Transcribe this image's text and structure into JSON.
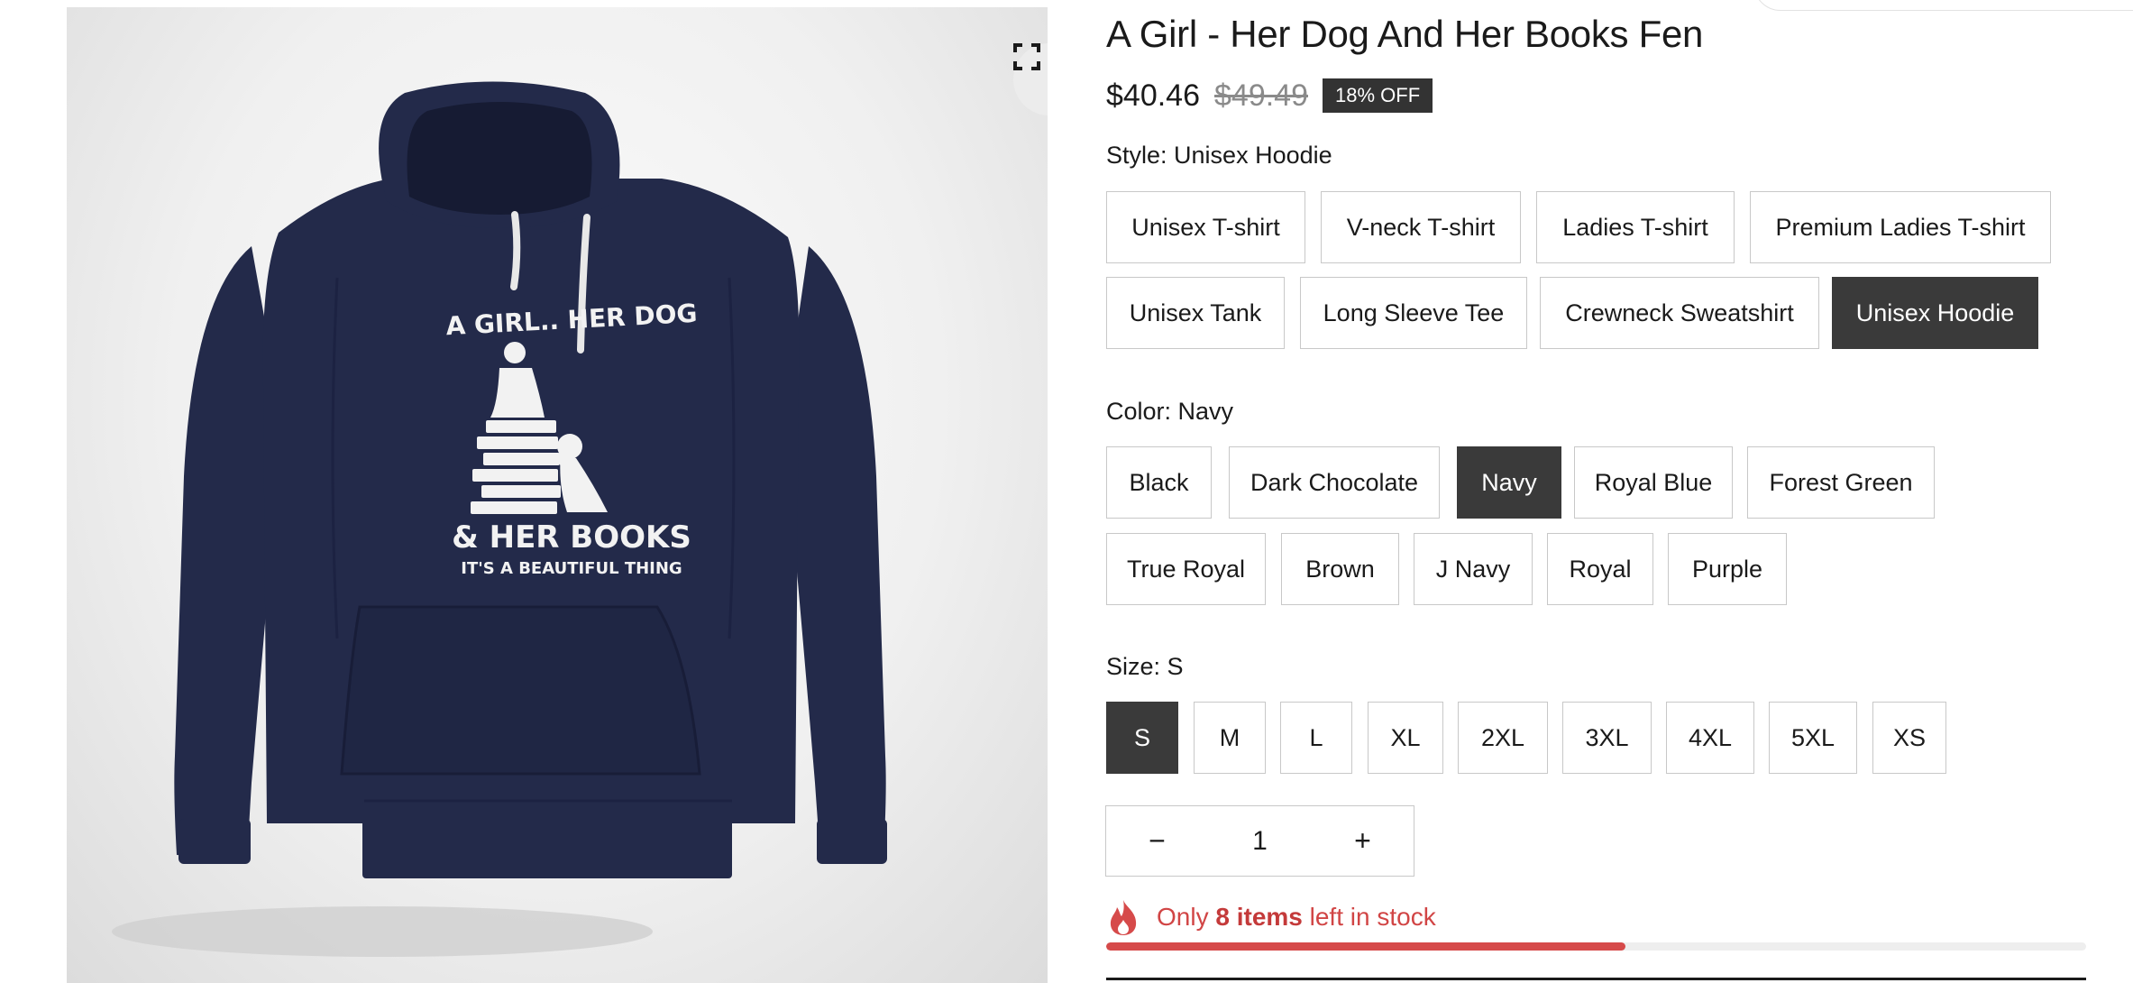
{
  "product": {
    "title": "A Girl - Her Dog And Her Books Fen",
    "price": "$40.46",
    "original_price": "$49.49",
    "discount_badge": "18% OFF",
    "print_lines": [
      "A GIRL.. HER DOG",
      "& HER BOOKS",
      "IT'S A BEAUTIFUL THING"
    ]
  },
  "style": {
    "label": "Style:",
    "selected": "Unisex Hoodie",
    "options": [
      "Unisex T-shirt",
      "V-neck T-shirt",
      "Ladies T-shirt",
      "Premium Ladies T-shirt",
      "Unisex Tank",
      "Long Sleeve Tee",
      "Crewneck Sweatshirt",
      "Unisex Hoodie"
    ]
  },
  "color": {
    "label": "Color:",
    "selected": "Navy",
    "options": [
      "Black",
      "Dark Chocolate",
      "Navy",
      "Royal Blue",
      "Forest Green",
      "True Royal",
      "Brown",
      "J Navy",
      "Royal",
      "Purple"
    ]
  },
  "size": {
    "label": "Size:",
    "selected": "S",
    "options": [
      "S",
      "M",
      "L",
      "XL",
      "2XL",
      "3XL",
      "4XL",
      "5XL",
      "XS"
    ]
  },
  "quantity": {
    "minus": "−",
    "value": "1",
    "plus": "+"
  },
  "stock": {
    "prefix": "Only",
    "count": "8 items",
    "suffix": "left in stock",
    "progress_fraction": 0.53
  },
  "colors": {
    "selected_bg": "#3a3a3a",
    "stock_red": "#d64a4a",
    "hoodie_navy": "#232a4a"
  },
  "icons": {
    "zoom": "expand-icon",
    "flame": "flame-icon"
  }
}
